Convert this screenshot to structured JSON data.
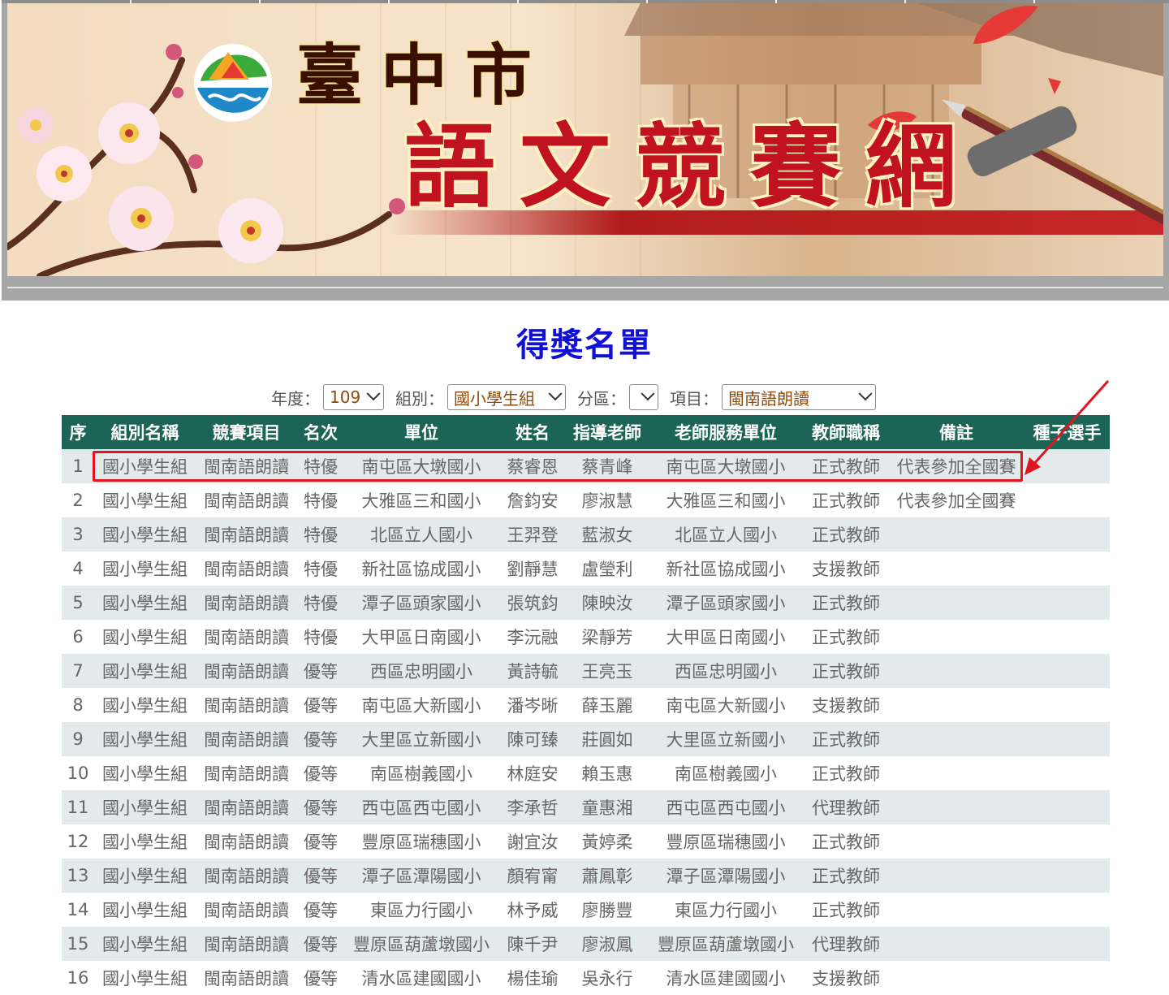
{
  "banner": {
    "city": "臺中市",
    "site_name": "語文競賽網",
    "colors": {
      "title_red": "#c1121f",
      "city_dark": "#3a0f00",
      "frame": "#a6a6a6"
    }
  },
  "page_title": "得獎名單",
  "filters": {
    "year": {
      "label": "年度：",
      "value": "109"
    },
    "group": {
      "label": "組別：",
      "value": "國小學生組"
    },
    "area": {
      "label": "分區：",
      "value": ""
    },
    "item": {
      "label": "項目：",
      "value": "閩南語朗讀"
    }
  },
  "table": {
    "header_color": "#1b6456",
    "columns": [
      "序",
      "組別名稱",
      "競賽項目",
      "名次",
      "單位",
      "姓名",
      "指導老師",
      "老師服務單位",
      "教師職稱",
      "備註",
      "種子選手"
    ],
    "rows": [
      [
        "1",
        "國小學生組",
        "閩南語朗讀",
        "特優",
        "南屯區大墩國小",
        "蔡睿恩",
        "蔡青峰",
        "南屯區大墩國小",
        "正式教師",
        "代表參加全國賽",
        ""
      ],
      [
        "2",
        "國小學生組",
        "閩南語朗讀",
        "特優",
        "大雅區三和國小",
        "詹鈞安",
        "廖淑慧",
        "大雅區三和國小",
        "正式教師",
        "代表參加全國賽",
        ""
      ],
      [
        "3",
        "國小學生組",
        "閩南語朗讀",
        "特優",
        "北區立人國小",
        "王羿登",
        "藍淑女",
        "北區立人國小",
        "正式教師",
        "",
        ""
      ],
      [
        "4",
        "國小學生組",
        "閩南語朗讀",
        "特優",
        "新社區協成國小",
        "劉靜慧",
        "盧瑩利",
        "新社區協成國小",
        "支援教師",
        "",
        ""
      ],
      [
        "5",
        "國小學生組",
        "閩南語朗讀",
        "特優",
        "潭子區頭家國小",
        "張筑鈞",
        "陳映汝",
        "潭子區頭家國小",
        "正式教師",
        "",
        ""
      ],
      [
        "6",
        "國小學生組",
        "閩南語朗讀",
        "特優",
        "大甲區日南國小",
        "李沅融",
        "梁靜芳",
        "大甲區日南國小",
        "正式教師",
        "",
        ""
      ],
      [
        "7",
        "國小學生組",
        "閩南語朗讀",
        "優等",
        "西區忠明國小",
        "黃詩毓",
        "王亮玉",
        "西區忠明國小",
        "正式教師",
        "",
        ""
      ],
      [
        "8",
        "國小學生組",
        "閩南語朗讀",
        "優等",
        "南屯區大新國小",
        "潘岑晰",
        "薛玉麗",
        "南屯區大新國小",
        "支援教師",
        "",
        ""
      ],
      [
        "9",
        "國小學生組",
        "閩南語朗讀",
        "優等",
        "大里區立新國小",
        "陳可臻",
        "莊圓如",
        "大里區立新國小",
        "正式教師",
        "",
        ""
      ],
      [
        "10",
        "國小學生組",
        "閩南語朗讀",
        "優等",
        "南區樹義國小",
        "林庭安",
        "賴玉惠",
        "南區樹義國小",
        "正式教師",
        "",
        ""
      ],
      [
        "11",
        "國小學生組",
        "閩南語朗讀",
        "優等",
        "西屯區西屯國小",
        "李承哲",
        "童惠湘",
        "西屯區西屯國小",
        "代理教師",
        "",
        ""
      ],
      [
        "12",
        "國小學生組",
        "閩南語朗讀",
        "優等",
        "豐原區瑞穗國小",
        "謝宜汝",
        "黃婷柔",
        "豐原區瑞穗國小",
        "正式教師",
        "",
        ""
      ],
      [
        "13",
        "國小學生組",
        "閩南語朗讀",
        "優等",
        "潭子區潭陽國小",
        "顏宥甯",
        "蕭鳳彰",
        "潭子區潭陽國小",
        "正式教師",
        "",
        ""
      ],
      [
        "14",
        "國小學生組",
        "閩南語朗讀",
        "優等",
        "東區力行國小",
        "林予威",
        "廖勝豐",
        "東區力行國小",
        "正式教師",
        "",
        ""
      ],
      [
        "15",
        "國小學生組",
        "閩南語朗讀",
        "優等",
        "豐原區葫蘆墩國小",
        "陳千尹",
        "廖淑鳳",
        "豐原區葫蘆墩國小",
        "代理教師",
        "",
        ""
      ],
      [
        "16",
        "國小學生組",
        "閩南語朗讀",
        "優等",
        "清水區建國國小",
        "楊佳瑜",
        "吳永行",
        "清水區建國國小",
        "支援教師",
        "",
        ""
      ]
    ]
  },
  "annotation": {
    "color": "#e0151f"
  }
}
